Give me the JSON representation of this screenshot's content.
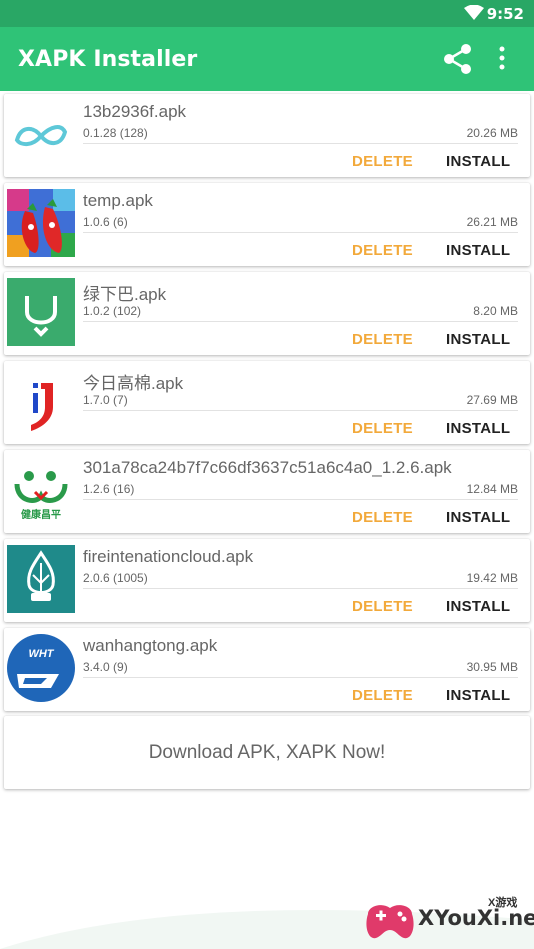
{
  "status_bar": {
    "time": "9:52",
    "wifi_icon": "wifi-icon"
  },
  "app_bar": {
    "title": "XAPK Installer",
    "share_icon": "share-icon",
    "more_icon": "more-vert-icon"
  },
  "actions": {
    "delete_label": "DELETE",
    "install_label": "INSTALL"
  },
  "colors": {
    "status_bar": "#29a765",
    "app_bar": "#2fc377",
    "delete": "#f2a93b",
    "install": "#222222"
  },
  "apps": [
    {
      "name": "13b2936f.apk",
      "version": "0.1.28 (128)",
      "size": "20.26 MB",
      "icon": "infinity-logo-icon"
    },
    {
      "name": "temp.apk",
      "version": "1.0.6 (6)",
      "size": "26.21 MB",
      "icon": "chili-game-icon"
    },
    {
      "name": "绿下巴.apk",
      "version": "1.0.2 (102)",
      "size": "8.20 MB",
      "icon": "green-chin-icon"
    },
    {
      "name": "今日高棉.apk",
      "version": "1.7.0 (7)",
      "size": "27.69 MB",
      "icon": "red-blue-j-icon"
    },
    {
      "name": "301a78ca24b7f7c66df3637c51a6c4a0_1.2.6.apk",
      "version": "1.2.6 (16)",
      "size": "12.84 MB",
      "icon": "health-app-icon",
      "icon_text": "健康昌平"
    },
    {
      "name": "fireintenationcloud.apk",
      "version": "2.0.6 (1005)",
      "size": "19.42 MB",
      "icon": "fire-cloud-icon"
    },
    {
      "name": "wanhangtong.apk",
      "version": "3.4.0 (9)",
      "size": "30.95 MB",
      "icon": "wht-logo-icon",
      "icon_text": "WHT"
    }
  ],
  "banner": {
    "text": "Download APK, XAPK Now!"
  },
  "watermark": {
    "text": "XYouXi.net",
    "sub": "X游戏"
  }
}
